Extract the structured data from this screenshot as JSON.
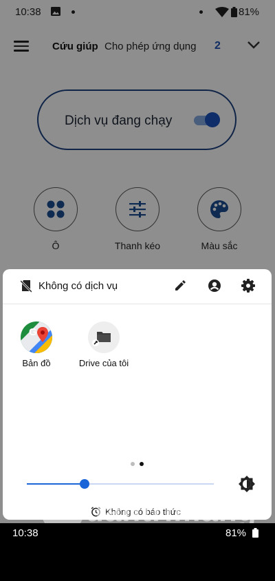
{
  "status_bar": {
    "time": "10:38",
    "battery": "81%"
  },
  "header": {
    "tab_primary": "Cứu giúp",
    "tab_secondary": "Cho phép ứng dụng",
    "count": "2"
  },
  "service": {
    "label": "Dịch vụ đang chạy",
    "enabled": true
  },
  "features": [
    {
      "label": "Ô",
      "icon": "grid-dots-icon"
    },
    {
      "label": "Thanh kéo",
      "icon": "sliders-icon"
    },
    {
      "label": "Màu sắc",
      "icon": "palette-icon"
    }
  ],
  "sheet": {
    "title": "Không có dịch vụ",
    "apps": [
      {
        "label": "Bản đồ",
        "icon": "google-maps-icon"
      },
      {
        "label": "Drive của tôi",
        "icon": "drive-folder-shortcut-icon"
      }
    ],
    "brightness_fraction": 0.31,
    "alarm": "Không có báo thức",
    "pager": {
      "pages": 2,
      "current": 2
    }
  },
  "bottom_bar": {
    "time": "10:38",
    "battery": "81%"
  },
  "watermark": {
    "text": "uantrimang"
  },
  "colors": {
    "accent": "#1a66d8",
    "dark_blue": "#1a3f7a",
    "toggle_thumb": "#1a4fb4",
    "count": "#1e4fa8"
  }
}
